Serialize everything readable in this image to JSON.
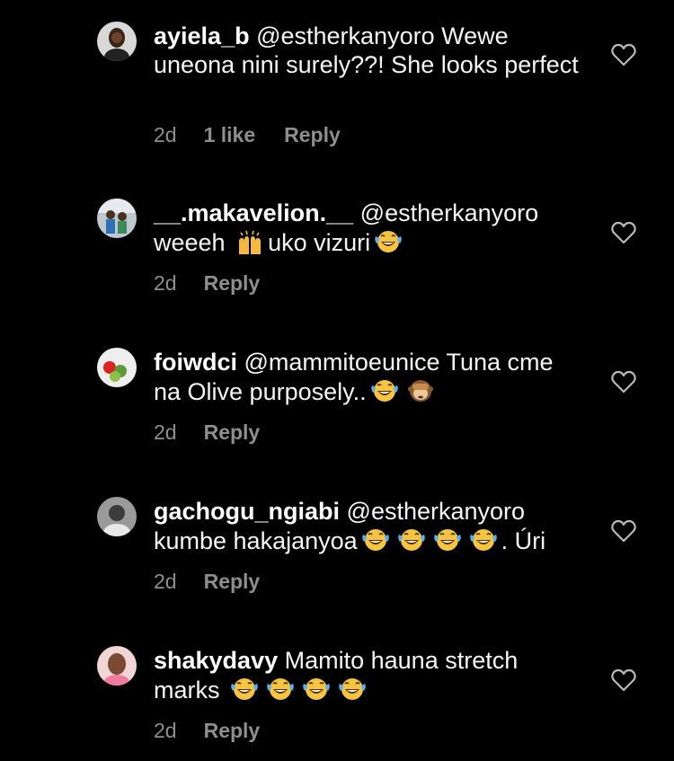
{
  "comments": [
    {
      "username": "ayiela_b",
      "mention": "@estherkanyoro",
      "text": " Wewe uneona nini surely??! She looks perfect",
      "time": "2d",
      "likes": "1 like",
      "reply": "Reply",
      "emojis": []
    },
    {
      "username": "__.makavelion.__",
      "mention": "@estherkanyoro",
      "text_before": " weeeh ",
      "text_after": "uko vizuri",
      "time": "2d",
      "reply": "Reply",
      "emojis": [
        "raising-hands",
        "laughing-tears"
      ]
    },
    {
      "username": "foiwdci",
      "mention": "@mammitoeunice",
      "text": " Tuna cme na Olive purposely..",
      "time": "2d",
      "reply": "Reply",
      "emojis": [
        "laughing-tears",
        "see-no-evil-monkey"
      ]
    },
    {
      "username": "gachogu_ngiabi",
      "mention": "@estherkanyoro",
      "text": " kumbe hakajanyoa",
      "text_after": ". Úri",
      "time": "2d",
      "reply": "Reply",
      "emojis": [
        "laughing-tears",
        "laughing-tears",
        "laughing-tears",
        "laughing-tears"
      ]
    },
    {
      "username": "shakydavy",
      "text": " Mamito hauna stretch marks ",
      "time": "2d",
      "reply": "Reply",
      "emojis": [
        "laughing-tears",
        "laughing-tears",
        "laughing-tears",
        "laughing-tears"
      ]
    }
  ],
  "colors": {
    "background": "#000000",
    "text": "#f5f5f5",
    "meta": "#8e8e8e",
    "heart_outline": "#b8b8b8"
  },
  "icons": {
    "like": "heart-outline-icon"
  }
}
